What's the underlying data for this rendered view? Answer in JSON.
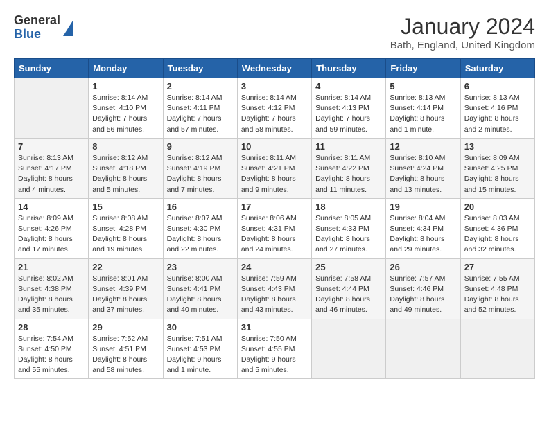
{
  "header": {
    "logo_general": "General",
    "logo_blue": "Blue",
    "month_title": "January 2024",
    "location": "Bath, England, United Kingdom"
  },
  "days_of_week": [
    "Sunday",
    "Monday",
    "Tuesday",
    "Wednesday",
    "Thursday",
    "Friday",
    "Saturday"
  ],
  "weeks": [
    [
      {
        "day": "",
        "detail": ""
      },
      {
        "day": "1",
        "detail": "Sunrise: 8:14 AM\nSunset: 4:10 PM\nDaylight: 7 hours\nand 56 minutes."
      },
      {
        "day": "2",
        "detail": "Sunrise: 8:14 AM\nSunset: 4:11 PM\nDaylight: 7 hours\nand 57 minutes."
      },
      {
        "day": "3",
        "detail": "Sunrise: 8:14 AM\nSunset: 4:12 PM\nDaylight: 7 hours\nand 58 minutes."
      },
      {
        "day": "4",
        "detail": "Sunrise: 8:14 AM\nSunset: 4:13 PM\nDaylight: 7 hours\nand 59 minutes."
      },
      {
        "day": "5",
        "detail": "Sunrise: 8:13 AM\nSunset: 4:14 PM\nDaylight: 8 hours\nand 1 minute."
      },
      {
        "day": "6",
        "detail": "Sunrise: 8:13 AM\nSunset: 4:16 PM\nDaylight: 8 hours\nand 2 minutes."
      }
    ],
    [
      {
        "day": "7",
        "detail": "Sunrise: 8:13 AM\nSunset: 4:17 PM\nDaylight: 8 hours\nand 4 minutes."
      },
      {
        "day": "8",
        "detail": "Sunrise: 8:12 AM\nSunset: 4:18 PM\nDaylight: 8 hours\nand 5 minutes."
      },
      {
        "day": "9",
        "detail": "Sunrise: 8:12 AM\nSunset: 4:19 PM\nDaylight: 8 hours\nand 7 minutes."
      },
      {
        "day": "10",
        "detail": "Sunrise: 8:11 AM\nSunset: 4:21 PM\nDaylight: 8 hours\nand 9 minutes."
      },
      {
        "day": "11",
        "detail": "Sunrise: 8:11 AM\nSunset: 4:22 PM\nDaylight: 8 hours\nand 11 minutes."
      },
      {
        "day": "12",
        "detail": "Sunrise: 8:10 AM\nSunset: 4:24 PM\nDaylight: 8 hours\nand 13 minutes."
      },
      {
        "day": "13",
        "detail": "Sunrise: 8:09 AM\nSunset: 4:25 PM\nDaylight: 8 hours\nand 15 minutes."
      }
    ],
    [
      {
        "day": "14",
        "detail": "Sunrise: 8:09 AM\nSunset: 4:26 PM\nDaylight: 8 hours\nand 17 minutes."
      },
      {
        "day": "15",
        "detail": "Sunrise: 8:08 AM\nSunset: 4:28 PM\nDaylight: 8 hours\nand 19 minutes."
      },
      {
        "day": "16",
        "detail": "Sunrise: 8:07 AM\nSunset: 4:30 PM\nDaylight: 8 hours\nand 22 minutes."
      },
      {
        "day": "17",
        "detail": "Sunrise: 8:06 AM\nSunset: 4:31 PM\nDaylight: 8 hours\nand 24 minutes."
      },
      {
        "day": "18",
        "detail": "Sunrise: 8:05 AM\nSunset: 4:33 PM\nDaylight: 8 hours\nand 27 minutes."
      },
      {
        "day": "19",
        "detail": "Sunrise: 8:04 AM\nSunset: 4:34 PM\nDaylight: 8 hours\nand 29 minutes."
      },
      {
        "day": "20",
        "detail": "Sunrise: 8:03 AM\nSunset: 4:36 PM\nDaylight: 8 hours\nand 32 minutes."
      }
    ],
    [
      {
        "day": "21",
        "detail": "Sunrise: 8:02 AM\nSunset: 4:38 PM\nDaylight: 8 hours\nand 35 minutes."
      },
      {
        "day": "22",
        "detail": "Sunrise: 8:01 AM\nSunset: 4:39 PM\nDaylight: 8 hours\nand 37 minutes."
      },
      {
        "day": "23",
        "detail": "Sunrise: 8:00 AM\nSunset: 4:41 PM\nDaylight: 8 hours\nand 40 minutes."
      },
      {
        "day": "24",
        "detail": "Sunrise: 7:59 AM\nSunset: 4:43 PM\nDaylight: 8 hours\nand 43 minutes."
      },
      {
        "day": "25",
        "detail": "Sunrise: 7:58 AM\nSunset: 4:44 PM\nDaylight: 8 hours\nand 46 minutes."
      },
      {
        "day": "26",
        "detail": "Sunrise: 7:57 AM\nSunset: 4:46 PM\nDaylight: 8 hours\nand 49 minutes."
      },
      {
        "day": "27",
        "detail": "Sunrise: 7:55 AM\nSunset: 4:48 PM\nDaylight: 8 hours\nand 52 minutes."
      }
    ],
    [
      {
        "day": "28",
        "detail": "Sunrise: 7:54 AM\nSunset: 4:50 PM\nDaylight: 8 hours\nand 55 minutes."
      },
      {
        "day": "29",
        "detail": "Sunrise: 7:52 AM\nSunset: 4:51 PM\nDaylight: 8 hours\nand 58 minutes."
      },
      {
        "day": "30",
        "detail": "Sunrise: 7:51 AM\nSunset: 4:53 PM\nDaylight: 9 hours\nand 1 minute."
      },
      {
        "day": "31",
        "detail": "Sunrise: 7:50 AM\nSunset: 4:55 PM\nDaylight: 9 hours\nand 5 minutes."
      },
      {
        "day": "",
        "detail": ""
      },
      {
        "day": "",
        "detail": ""
      },
      {
        "day": "",
        "detail": ""
      }
    ]
  ]
}
